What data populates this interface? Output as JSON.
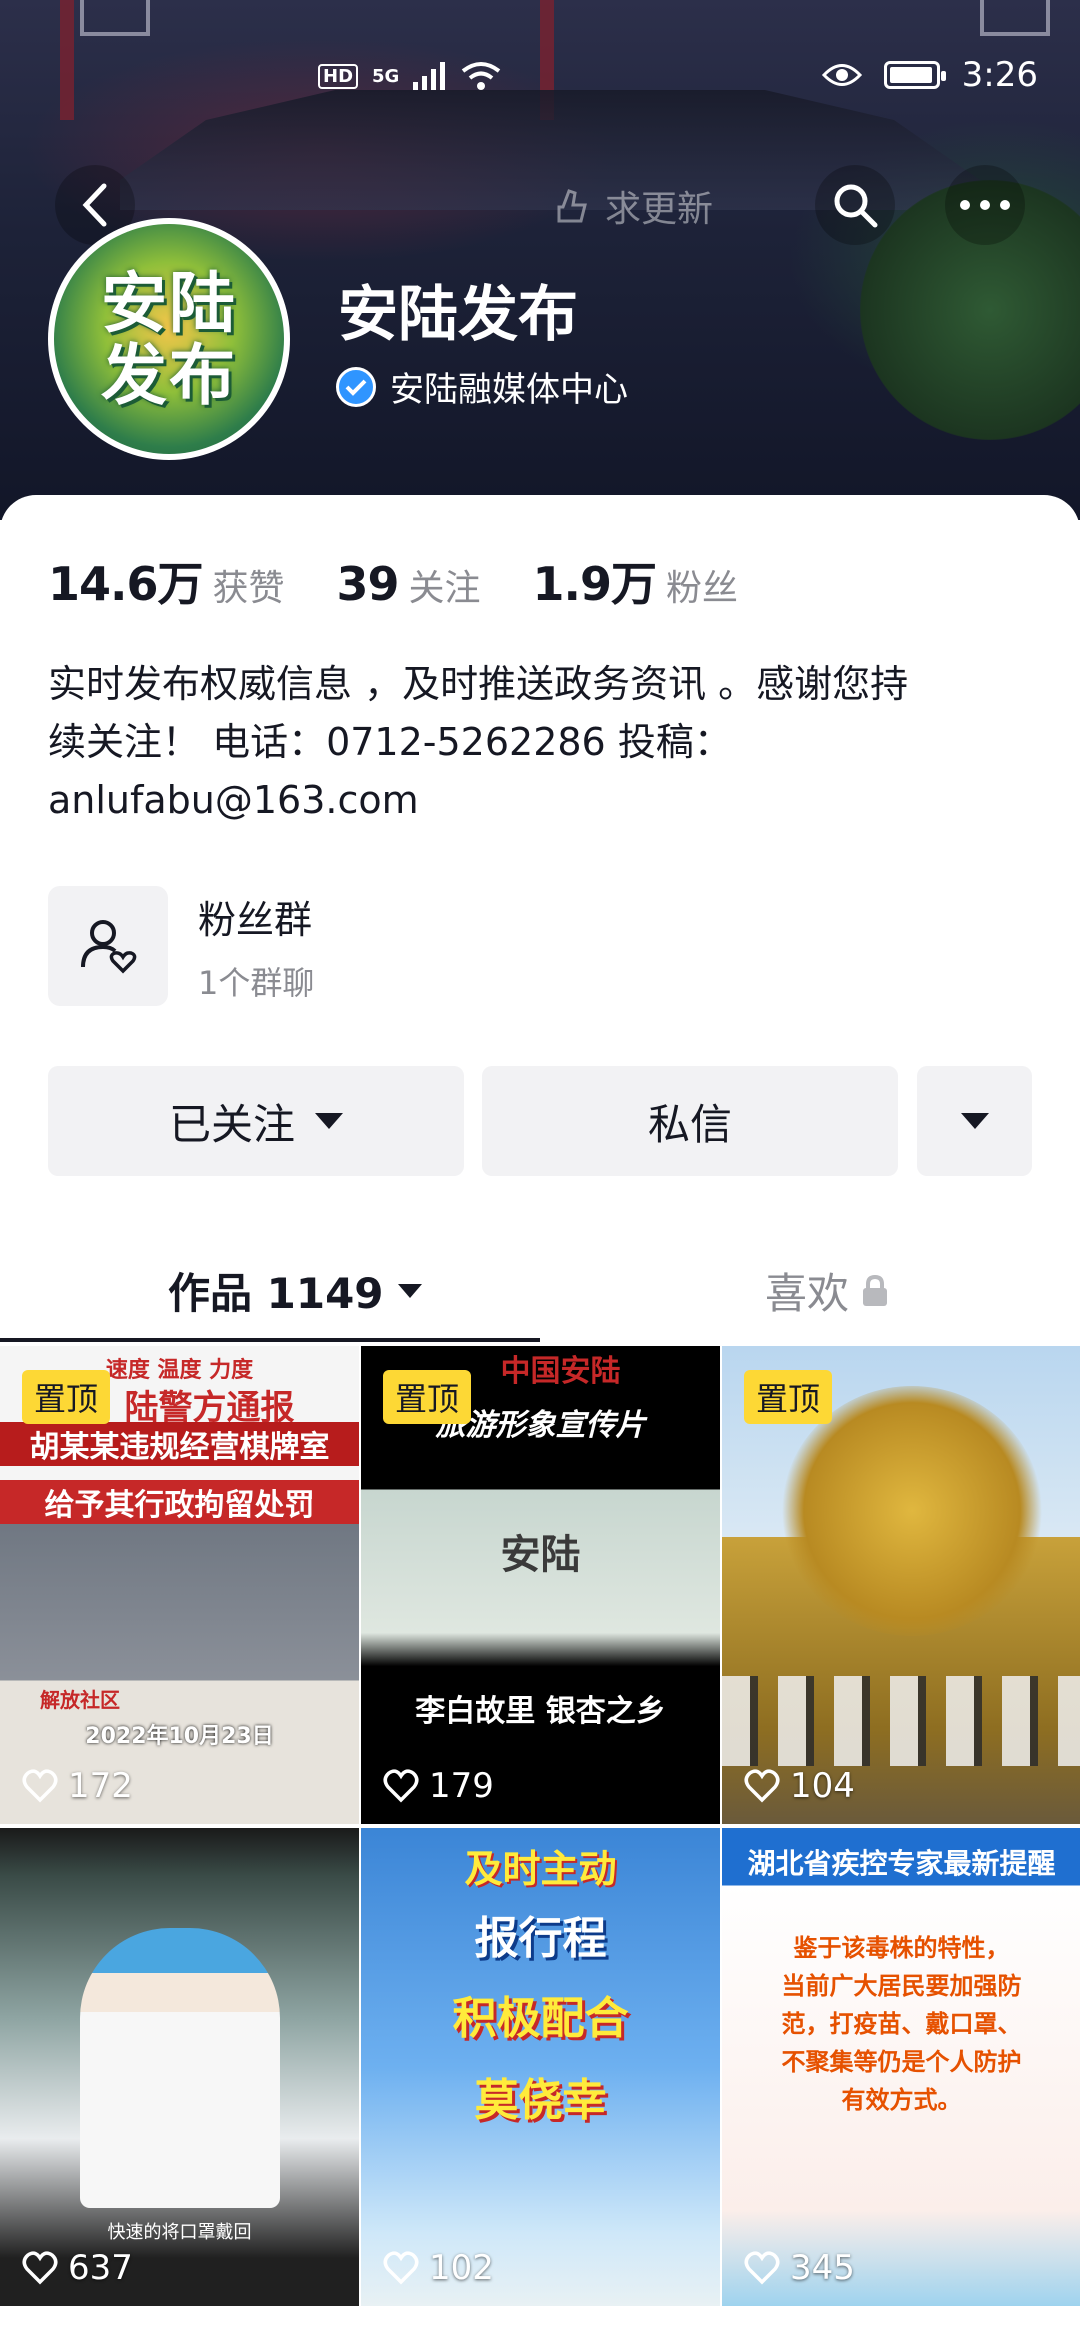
{
  "status_bar": {
    "network_hd": "HD",
    "network_5g": "5G",
    "time": "3:26"
  },
  "nav": {
    "request_update_label": "求更新"
  },
  "profile": {
    "avatar_text_line1": "安陆",
    "avatar_text_line2": "发布",
    "name": "安陆发布",
    "verification": "安陆融媒体中心"
  },
  "stats": {
    "likes_value": "14.6万",
    "likes_label": "获赞",
    "following_value": "39",
    "following_label": "关注",
    "followers_value": "1.9万",
    "followers_label": "粉丝"
  },
  "bio": {
    "line1": "实时发布权威信息 ，及时推送政务资讯 。感谢您持",
    "line2": "续关注！ 电话：0712-5262286  投稿：",
    "line3": "anlufabu@163.com"
  },
  "fans_group": {
    "title": "粉丝群",
    "subtitle": "1个群聊"
  },
  "actions": {
    "followed_label": "已关注",
    "message_label": "私信"
  },
  "tabs": {
    "works_label": "作品 1149",
    "likes_label": "喜欢"
  },
  "videos": [
    {
      "pinned": "置顶",
      "likes": "172",
      "cap_top": "速度 温度 力度",
      "cap_a": "陆警方通报",
      "cap_b": "胡某某违规经营棋牌室",
      "cap_c": "给予其行政拘留处罚",
      "cap_d": "解放社区",
      "cap_e": "2022年10月23日"
    },
    {
      "pinned": "置顶",
      "likes": "179",
      "cap_top": "中国安陆",
      "cap_a": "旅游形象宣传片",
      "cap_b": "安陆",
      "cap_c": "李白故里  银杏之乡"
    },
    {
      "pinned": "置顶",
      "likes": "104"
    },
    {
      "likes": "637",
      "cap_a": "快速的将口罩戴回"
    },
    {
      "likes": "102",
      "cap_a": "及时主动",
      "cap_b": "报行程",
      "cap_c": "积极配合",
      "cap_d": "莫侥幸"
    },
    {
      "likes": "345",
      "cap_top": "湖北省疾控专家最新提醒",
      "cap_a": "鉴于该毒株的特性，",
      "cap_b": "当前广大居民要加强防",
      "cap_c": "范，打疫苗、戴口罩、",
      "cap_d": "不聚集等仍是个人防护",
      "cap_e": "有效方式。"
    }
  ],
  "colors": {
    "pin_badge": "#fdd835",
    "verify_badge": "#2f95ff",
    "button_bg": "#f2f2f4",
    "text_primary": "#161823",
    "text_secondary": "#8a8b91"
  }
}
